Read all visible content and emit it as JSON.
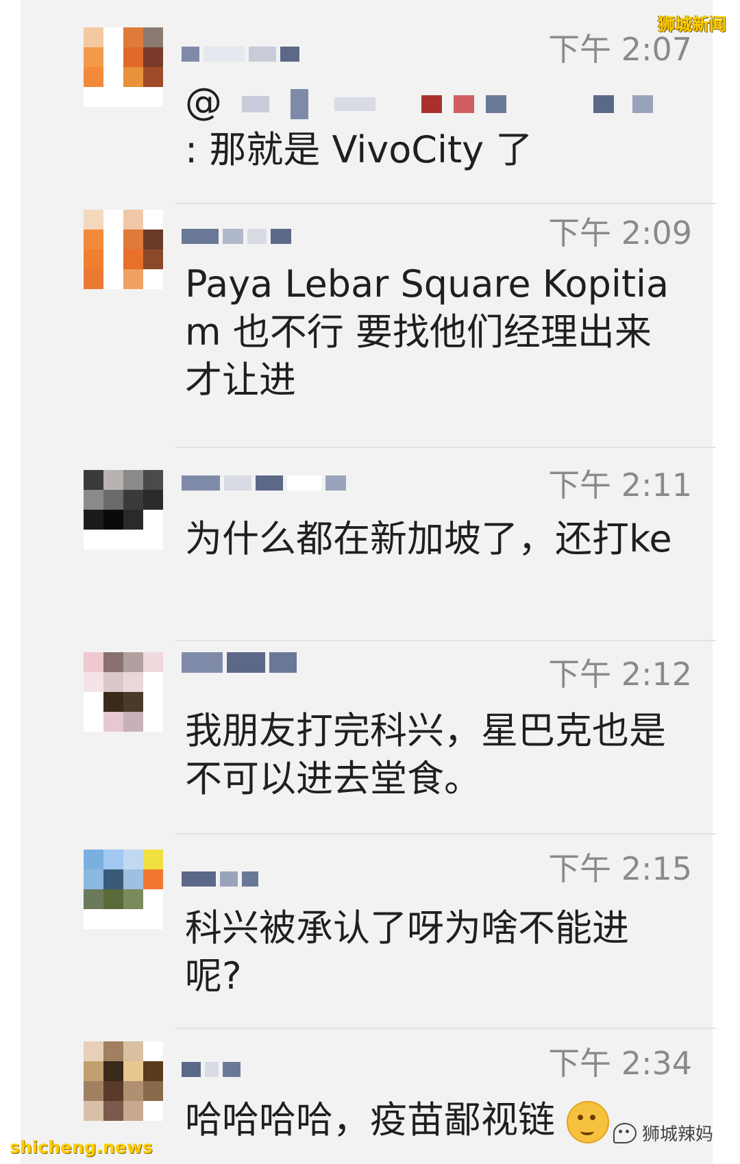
{
  "watermarks": {
    "top": "狮城新闻",
    "bottom": "shicheng.news",
    "brand": "狮城辣妈"
  },
  "messages": [
    {
      "time": "下午 2:07",
      "text": "@",
      "text2": ": 那就是 VivoCity 了"
    },
    {
      "time": "下午 2:09",
      "text": "Paya Lebar Square Kopitiam 也不行 要找他们经理出来才让进"
    },
    {
      "time": "下午 2:11",
      "text": "为什么都在新加坡了，还打ke"
    },
    {
      "time": "下午 2:12",
      "text": "我朋友打完科兴，星巴克也是不可以进去堂食。"
    },
    {
      "time": "下午 2:15",
      "text": "科兴被承认了呀为啥不能进呢?"
    },
    {
      "time": "下午 2:34",
      "text": "哈哈哈哈，疫苗鄙视链"
    }
  ],
  "colors": {
    "timestamp": "#8a8a8a",
    "watermark": "#ffcf00"
  }
}
